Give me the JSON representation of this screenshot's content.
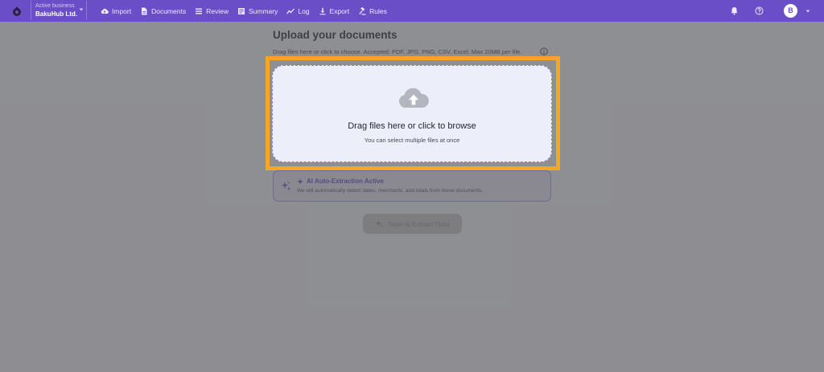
{
  "header": {
    "business_label": "Active business",
    "business_name": "BakuHub Ltd.",
    "nav": [
      {
        "label": "Import",
        "icon": "cloud-upload-icon"
      },
      {
        "label": "Documents",
        "icon": "document-icon"
      },
      {
        "label": "Review",
        "icon": "list-icon"
      },
      {
        "label": "Summary",
        "icon": "summary-icon"
      },
      {
        "label": "Log",
        "icon": "trend-icon"
      },
      {
        "label": "Export",
        "icon": "download-icon"
      },
      {
        "label": "Rules",
        "icon": "gavel-icon"
      }
    ],
    "avatar_initial": "B"
  },
  "main": {
    "title": "Upload your documents",
    "hint": "Drag files here or click to choose. Accepted: PDF, JPG, PNG, CSV, Excel. Max 20MB per file.",
    "dropzone": {
      "main_text": "Drag files here or click to browse",
      "sub_text": "You can select multiple files at once"
    },
    "ai": {
      "title": "AI Auto-Extraction Active",
      "description": "We will automatically detect dates, merchants, and totals from these documents."
    },
    "scan_button": "Scan & Extract Data"
  },
  "colors": {
    "header_bg": "#6a4ec7",
    "accent": "#5b3fc4",
    "highlight": "#f5a623"
  }
}
